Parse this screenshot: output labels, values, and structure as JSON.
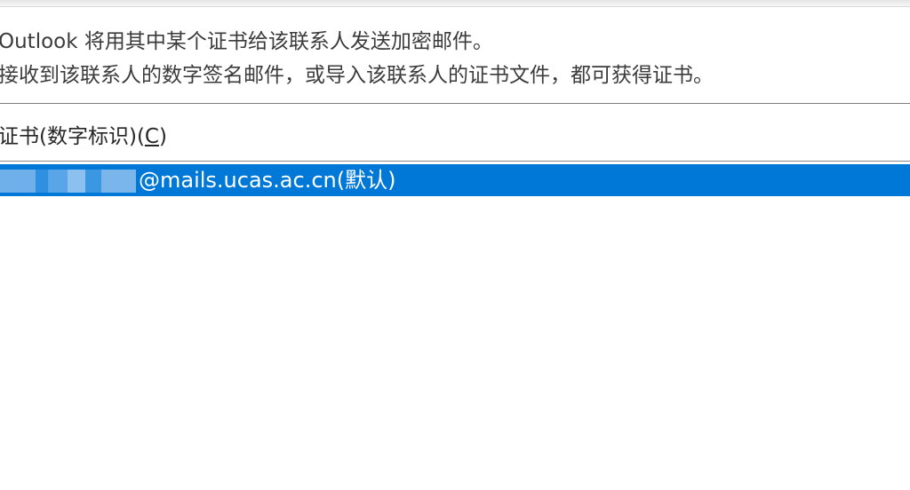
{
  "description": {
    "line1": "Outlook 将用其中某个证书给该联系人发送加密邮件。",
    "line2": "接收到该联系人的数字签名邮件，或导入该联系人的证书文件，都可获得证书。"
  },
  "certificates": {
    "label_prefix": "证书(数字标识)(",
    "label_accel": "C",
    "label_suffix": ")",
    "items": [
      {
        "email": "@mails.ucas.ac.cn(默认)",
        "selected": true
      }
    ]
  },
  "colors": {
    "selection": "#0078d7",
    "text": "#262626",
    "selected_text": "#ffffff"
  }
}
